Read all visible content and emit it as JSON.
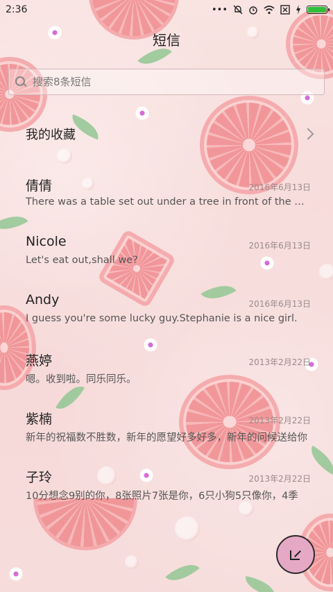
{
  "status_bar": {
    "time": "2:36",
    "icons": [
      "more-icon",
      "mute-icon",
      "alarm-icon",
      "wifi-icon",
      "sim-icon",
      "charging-icon",
      "battery-icon"
    ],
    "dots": "•••",
    "battery_color": "#2fbf3a"
  },
  "header": {
    "title": "短信"
  },
  "search": {
    "placeholder": "搜索8条短信"
  },
  "favorites": {
    "label": "我的收藏"
  },
  "conversations": [
    {
      "name": "倩倩",
      "date": "2016年6月13日",
      "preview": "There was a table set out under a tree in front of the house"
    },
    {
      "name": "Nicole",
      "date": "2016年6月13日",
      "preview": "Let's eat out,shall we?"
    },
    {
      "name": "Andy",
      "date": "2016年6月13日",
      "preview": "I guess you're some lucky guy.Stephanie is a nice girl."
    },
    {
      "name": "燕婷",
      "date": "2013年2月22日",
      "preview": "嗯。收到啦。同乐同乐。"
    },
    {
      "name": "紫楠",
      "date": "2013年2月22日",
      "preview": "新年的祝福数不胜数，新年的愿望好多好多，新年的问候送给你"
    },
    {
      "name": "子玲",
      "date": "2013年2月22日",
      "preview": "10分想念9别的你，8张照片7张是你，6只小狗5只像你，4季"
    }
  ],
  "compose": {
    "icon": "compose-icon",
    "color": "#e5a9c6"
  }
}
